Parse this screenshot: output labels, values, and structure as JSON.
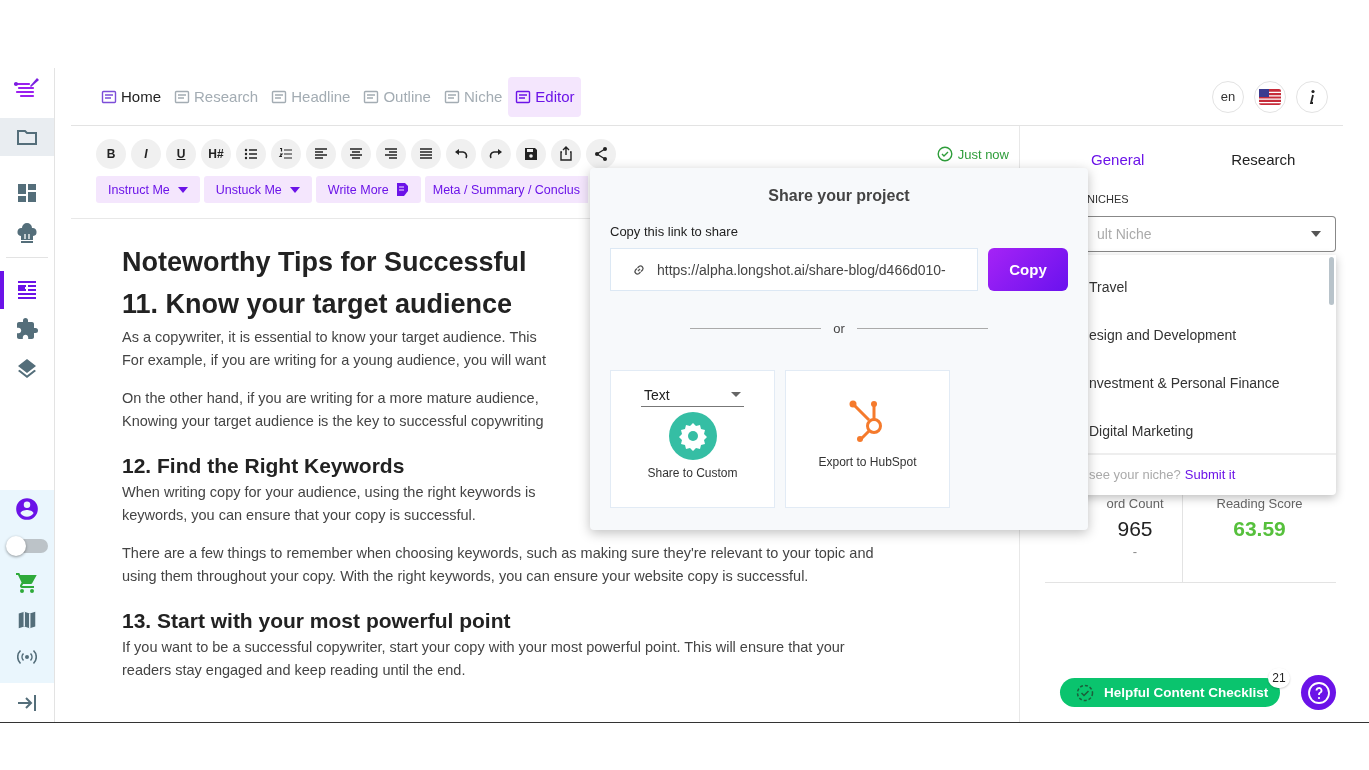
{
  "sidebar": {
    "items": [
      {
        "highlighted": true,
        "selected": false
      },
      {
        "highlighted": false,
        "selected": false
      },
      {
        "highlighted": false,
        "selected": false
      },
      {
        "highlighted": false,
        "selected": true
      },
      {
        "highlighted": false,
        "selected": false
      },
      {
        "highlighted": false,
        "selected": false
      }
    ],
    "toggle": {
      "on": false
    }
  },
  "nav": {
    "tabs": [
      {
        "label": "Home",
        "selected": false,
        "disabled": false
      },
      {
        "label": "Research",
        "selected": false,
        "disabled": true
      },
      {
        "label": "Headline",
        "selected": false,
        "disabled": true
      },
      {
        "label": "Outline",
        "selected": false,
        "disabled": true
      },
      {
        "label": "Niche",
        "selected": false,
        "disabled": true
      },
      {
        "label": "Editor",
        "selected": true,
        "disabled": false
      }
    ],
    "language": "en"
  },
  "toolbar": {
    "format_buttons": [
      "B",
      "I",
      "U",
      "H#"
    ],
    "save_status": "Just now",
    "actions": [
      {
        "label": "Instruct Me",
        "kind": "dropdown"
      },
      {
        "label": "Unstuck Me",
        "kind": "dropdown"
      },
      {
        "label": "Write More",
        "kind": "write"
      },
      {
        "label": "Meta / Summary / Conclus",
        "kind": "plain"
      }
    ]
  },
  "document": {
    "title": "Noteworthy Tips for Successful",
    "sections": [
      {
        "heading": "11. Know your target audience",
        "kind": "major",
        "paragraphs": [
          [
            "As a copywriter, it is essential to know your target audience. This",
            "For example, if you are writing for a young audience, you will want"
          ],
          [
            "On the other hand, if you are writing for a more mature audience,",
            "Knowing your target audience is the key to successful copywriting"
          ]
        ]
      },
      {
        "heading": "12. Find the Right Keywords",
        "kind": "minor",
        "paragraphs": [
          [
            "When writing copy for your audience, using the right keywords is",
            "keywords, you can ensure that your copy is successful."
          ],
          [
            "There are a few things to remember when choosing keywords, such as making sure they're relevant to your topic and",
            "using them throughout your copy. With the right keywords, you can ensure your website copy is successful."
          ]
        ]
      },
      {
        "heading": "13. Start with your most powerful point",
        "kind": "minor",
        "paragraphs": [
          [
            "If you want to be a successful copywriter, start your copy with your most powerful point. This will ensure that your",
            "readers stay engaged and keep reading until the end."
          ]
        ]
      }
    ]
  },
  "right_panel": {
    "tabs": [
      {
        "label": "General",
        "selected": true
      },
      {
        "label": "Research",
        "selected": false
      }
    ],
    "niches_label": "NICHES",
    "niche_placeholder": "ult Niche",
    "stats": [
      {
        "label": "ord Count",
        "value": "965",
        "note": "-",
        "kind": "plain"
      },
      {
        "label": "Reading Score",
        "value": "63.59",
        "kind": "score"
      }
    ]
  },
  "niche_dropdown": {
    "options": [
      "Travel",
      "esign and Development",
      "nvestment & Personal Finance",
      "Digital Marketing"
    ],
    "footer": "see your niche?",
    "footer_link": "Submit it"
  },
  "share_popup": {
    "title": "Share your project",
    "link_label": "Copy this link to share",
    "link": "https://alpha.longshot.ai/share-blog/d466d010-",
    "copy_button": "Copy",
    "divider": "or",
    "format": "Text",
    "custom_label": "Share to Custom",
    "hubspot_label": "Export to HubSpot"
  },
  "checklist": {
    "label": "Helpful Content Checklist",
    "count": "21"
  }
}
